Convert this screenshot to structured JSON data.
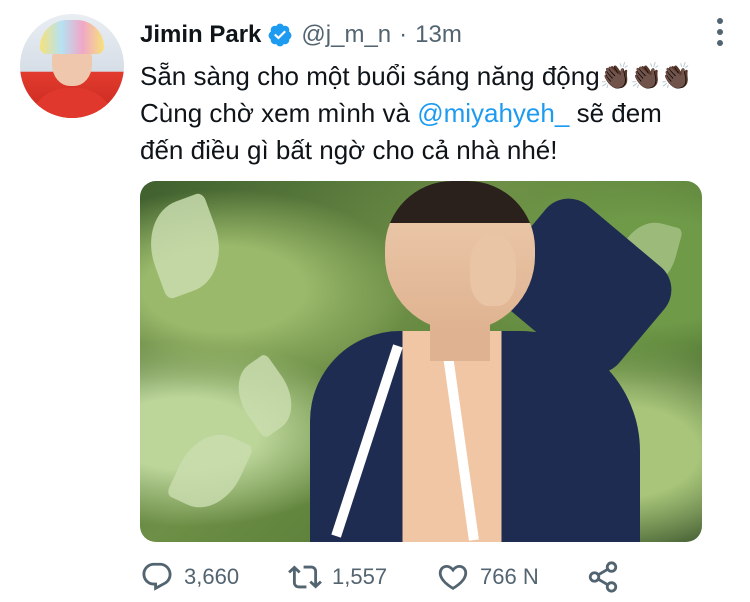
{
  "tweet": {
    "author": {
      "name": "Jimin Park",
      "handle": "@j_m_n",
      "separator": "·",
      "time": "13m"
    },
    "text": {
      "line1_prefix": "Sẵn sàng cho một buổi sáng năng động",
      "line1_emoji": "👏🏿👏🏿👏🏿",
      "line2_prefix": "Cùng chờ xem mình và",
      "line2_mention": "@miyahyeh_",
      "line2_suffix": "sẽ đem",
      "line3": "đến điều gì bất ngờ cho cả nhà nhé!"
    },
    "actions": {
      "replies": "3,660",
      "retweets": "1,557",
      "likes": "766 N"
    },
    "colors": {
      "accent": "#1d9bf0",
      "secondary_text": "#536471",
      "primary_text": "#0f1419"
    },
    "icons": [
      "verified-badge-icon",
      "more-icon",
      "reply-icon",
      "retweet-icon",
      "like-icon",
      "share-icon"
    ]
  }
}
